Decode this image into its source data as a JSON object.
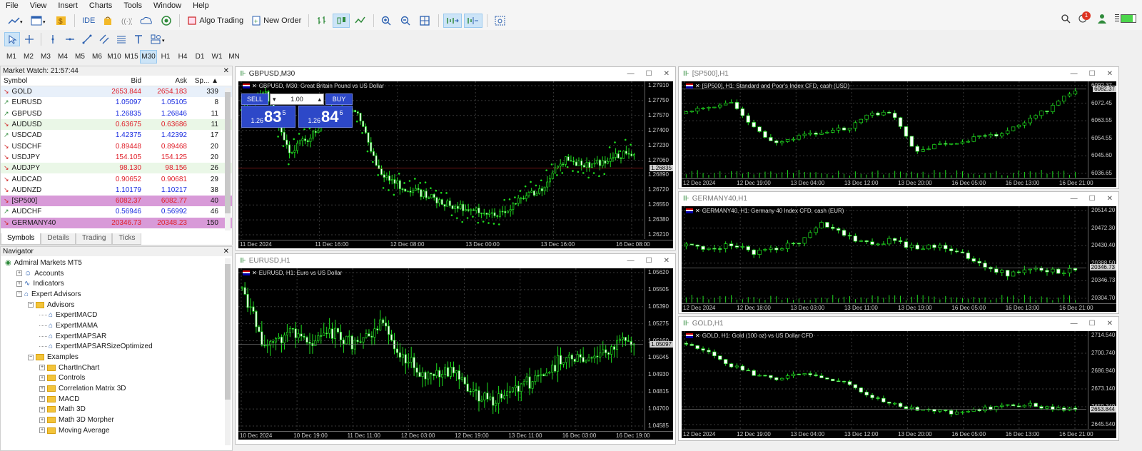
{
  "menu": [
    "File",
    "View",
    "Insert",
    "Charts",
    "Tools",
    "Window",
    "Help"
  ],
  "toolbar": {
    "ide_label": "IDE",
    "algo_label": "Algo Trading",
    "neworder_label": "New Order",
    "notif_count": "1"
  },
  "timeframes": [
    "M1",
    "M2",
    "M3",
    "M4",
    "M5",
    "M6",
    "M10",
    "M15",
    "M30",
    "H1",
    "H4",
    "D1",
    "W1",
    "MN"
  ],
  "active_timeframe": "M30",
  "market_watch": {
    "title": "Market Watch: 21:57:44",
    "headers": [
      "Symbol",
      "Bid",
      "Ask",
      "Sp..."
    ],
    "rows": [
      {
        "sym": "GOLD",
        "bid": "2653.844",
        "ask": "2654.183",
        "spr": "339",
        "dir": "down",
        "bg": "#e8f0fa",
        "color": "#e0202a"
      },
      {
        "sym": "EURUSD",
        "bid": "1.05097",
        "ask": "1.05105",
        "spr": "8",
        "dir": "up",
        "bg": "#ffffff",
        "color": "#1a2de0"
      },
      {
        "sym": "GBPUSD",
        "bid": "1.26835",
        "ask": "1.26846",
        "spr": "11",
        "dir": "up",
        "bg": "#ffffff",
        "color": "#1a2de0"
      },
      {
        "sym": "AUDUSD",
        "bid": "0.63675",
        "ask": "0.63686",
        "spr": "11",
        "dir": "down",
        "bg": "#eaf7e7",
        "color": "#e0202a"
      },
      {
        "sym": "USDCAD",
        "bid": "1.42375",
        "ask": "1.42392",
        "spr": "17",
        "dir": "up",
        "bg": "#ffffff",
        "color": "#1a2de0"
      },
      {
        "sym": "USDCHF",
        "bid": "0.89448",
        "ask": "0.89468",
        "spr": "20",
        "dir": "down",
        "bg": "#ffffff",
        "color": "#e0202a"
      },
      {
        "sym": "USDJPY",
        "bid": "154.105",
        "ask": "154.125",
        "spr": "20",
        "dir": "down",
        "bg": "#ffffff",
        "color": "#e0202a"
      },
      {
        "sym": "AUDJPY",
        "bid": "98.130",
        "ask": "98.156",
        "spr": "26",
        "dir": "down",
        "bg": "#eaf7e7",
        "color": "#e0202a"
      },
      {
        "sym": "AUDCAD",
        "bid": "0.90652",
        "ask": "0.90681",
        "spr": "29",
        "dir": "down",
        "bg": "#ffffff",
        "color": "#e0202a"
      },
      {
        "sym": "AUDNZD",
        "bid": "1.10179",
        "ask": "1.10217",
        "spr": "38",
        "dir": "down",
        "bg": "#ffffff",
        "color": "#1a2de0"
      },
      {
        "sym": "[SP500]",
        "bid": "6082.37",
        "ask": "6082.77",
        "spr": "40",
        "dir": "down",
        "bg": "#d89ad8",
        "color": "#e0202a"
      },
      {
        "sym": "AUDCHF",
        "bid": "0.56946",
        "ask": "0.56992",
        "spr": "46",
        "dir": "up",
        "bg": "#ffffff",
        "color": "#1a2de0"
      },
      {
        "sym": "GERMANY40",
        "bid": "20346.73",
        "ask": "20348.23",
        "spr": "150",
        "dir": "down",
        "bg": "#d89ad8",
        "color": "#e0202a"
      }
    ],
    "tabs": [
      "Symbols",
      "Details",
      "Trading",
      "Ticks"
    ]
  },
  "navigator": {
    "title": "Navigator",
    "items": [
      {
        "label": "Admiral Markets MT5",
        "indent": 0,
        "type": "root"
      },
      {
        "label": "Accounts",
        "indent": 1,
        "type": "acc"
      },
      {
        "label": "Indicators",
        "indent": 1,
        "type": "ind"
      },
      {
        "label": "Expert Advisors",
        "indent": 1,
        "type": "ea"
      },
      {
        "label": "Advisors",
        "indent": 2,
        "type": "folder"
      },
      {
        "label": "ExpertMACD",
        "indent": 3,
        "type": "expert"
      },
      {
        "label": "ExpertMAMA",
        "indent": 3,
        "type": "expert"
      },
      {
        "label": "ExpertMAPSAR",
        "indent": 3,
        "type": "expert"
      },
      {
        "label": "ExpertMAPSARSizeOptimized",
        "indent": 3,
        "type": "expert"
      },
      {
        "label": "Examples",
        "indent": 2,
        "type": "folder"
      },
      {
        "label": "ChartInChart",
        "indent": 3,
        "type": "folder"
      },
      {
        "label": "Controls",
        "indent": 3,
        "type": "folder"
      },
      {
        "label": "Correlation Matrix 3D",
        "indent": 3,
        "type": "folder"
      },
      {
        "label": "MACD",
        "indent": 3,
        "type": "folder"
      },
      {
        "label": "Math 3D",
        "indent": 3,
        "type": "folder"
      },
      {
        "label": "Math 3D Morpher",
        "indent": 3,
        "type": "folder"
      },
      {
        "label": "Moving Average",
        "indent": 3,
        "type": "folder"
      }
    ]
  },
  "charts": [
    {
      "id": "gbp",
      "win": "GBPUSD,M30",
      "title": "GBPUSD, M30:  Great Britain Pound vs US Dollar",
      "ticks": [
        "1.27910",
        "1.27750",
        "1.27570",
        "1.27400",
        "1.27230",
        "1.27060",
        "1.26890",
        "1.26720",
        "1.26550",
        "1.26380",
        "1.26210"
      ],
      "tag": "1.26835",
      "dates": [
        "11 Dec 2024",
        "11 Dec 16:00",
        "12 Dec 08:00",
        "13 Dec 00:00",
        "13 Dec 16:00",
        "16 Dec 08:00"
      ],
      "trend": [
        0.12,
        0.05,
        0.45,
        0.35,
        0.15,
        0.2,
        0.6,
        0.7,
        0.75,
        0.82,
        0.85,
        0.9,
        0.78,
        0.7,
        0.5,
        0.55,
        0.5,
        0.45
      ],
      "seed": 3
    },
    {
      "id": "eur",
      "win": "EURUSD,H1",
      "title": "EURUSD, H1:  Euro vs US Dollar",
      "ticks": [
        "1.05620",
        "1.05505",
        "1.05390",
        "1.05275",
        "1.05160",
        "1.05045",
        "1.04930",
        "1.04815",
        "1.04700",
        "1.04585"
      ],
      "tag": "1.05097",
      "dates": [
        "10 Dec 2024",
        "10 Dec 19:00",
        "11 Dec 11:00",
        "12 Dec 03:00",
        "12 Dec 19:00",
        "13 Dec 11:00",
        "16 Dec 03:00",
        "16 Dec 19:00"
      ],
      "trend": [
        0.1,
        0.5,
        0.4,
        0.45,
        0.4,
        0.5,
        0.35,
        0.55,
        0.7,
        0.65,
        0.8,
        0.85,
        0.75,
        0.7,
        0.55,
        0.6,
        0.5,
        0.45
      ],
      "seed": 7
    },
    {
      "id": "sp",
      "win": "[SP500],H1",
      "title": "[SP500], H1:  Standard and Poor's Index CFD, cash (USD)",
      "ticks": [
        "6092.37",
        "6072.45",
        "6063.55",
        "6054.55",
        "6045.60",
        "6036.65"
      ],
      "tag": "6082.37",
      "dates": [
        "12 Dec 2024",
        "12 Dec 19:00",
        "13 Dec 04:00",
        "13 Dec 12:00",
        "13 Dec 20:00",
        "16 Dec 05:00",
        "16 Dec 13:00",
        "16 Dec 21:00"
      ],
      "trend": [
        0.3,
        0.25,
        0.2,
        0.5,
        0.7,
        0.6,
        0.55,
        0.5,
        0.35,
        0.3,
        0.8,
        0.7,
        0.65,
        0.6,
        0.55,
        0.4,
        0.25,
        0.05
      ],
      "seed": 11
    },
    {
      "id": "ger",
      "win": "GERMANY40,H1",
      "title": "GERMANY40, H1:  Germany 40 Index CFD, cash (EUR)",
      "ticks": [
        "20514.20",
        "20472.30",
        "20430.40",
        "20388.50",
        "20346.73",
        "20304.70"
      ],
      "tag": "20346.73",
      "dates": [
        "12 Dec 2024",
        "12 Dec 18:00",
        "13 Dec 03:00",
        "13 Dec 11:00",
        "13 Dec 19:00",
        "16 Dec 05:00",
        "16 Dec 13:00",
        "16 Dec 21:00"
      ],
      "trend": [
        0.4,
        0.45,
        0.4,
        0.5,
        0.45,
        0.35,
        0.15,
        0.3,
        0.4,
        0.35,
        0.45,
        0.4,
        0.5,
        0.65,
        0.75,
        0.7,
        0.72,
        0.7
      ],
      "seed": 5
    },
    {
      "id": "gold",
      "win": "GOLD,H1",
      "title": "GOLD, H1:  Gold (100 oz) vs US Dollar CFD",
      "ticks": [
        "2714.540",
        "2700.740",
        "2686.940",
        "2673.140",
        "2659.340",
        "2645.540"
      ],
      "tag": "2653.844",
      "dates": [
        "12 Dec 2024",
        "12 Dec 19:00",
        "13 Dec 04:00",
        "13 Dec 12:00",
        "13 Dec 20:00",
        "16 Dec 05:00",
        "16 Dec 13:00",
        "16 Dec 21:00"
      ],
      "trend": [
        0.1,
        0.2,
        0.35,
        0.45,
        0.5,
        0.45,
        0.5,
        0.55,
        0.7,
        0.8,
        0.85,
        0.88,
        0.9,
        0.85,
        0.82,
        0.8,
        0.85,
        0.85
      ],
      "seed": 9
    }
  ],
  "oneclick": {
    "sell": "SELL",
    "buy": "BUY",
    "lot": "1.00",
    "sell_prefix": "1.26",
    "sell_big": "83",
    "sell_sup": "5",
    "buy_prefix": "1.26",
    "buy_big": "84",
    "buy_sup": "6"
  }
}
